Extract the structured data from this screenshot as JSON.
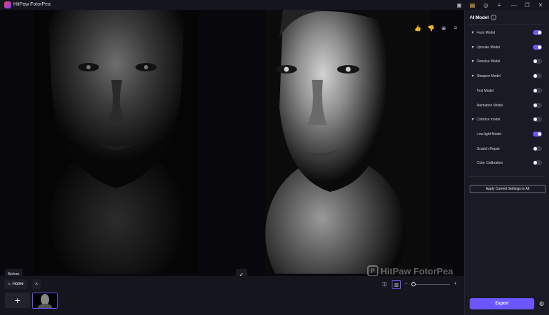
{
  "app": {
    "title": "HitPaw FotorPea"
  },
  "titlebar_icons": [
    {
      "name": "gamepad-icon",
      "glyph": "▣"
    },
    {
      "name": "gift-icon",
      "glyph": "▤"
    },
    {
      "name": "user-icon",
      "glyph": "◎"
    },
    {
      "name": "menu-icon",
      "glyph": "≡"
    },
    {
      "name": "minimize-icon",
      "glyph": "—"
    },
    {
      "name": "maximize-icon",
      "glyph": "❐"
    },
    {
      "name": "close-icon",
      "glyph": "✕"
    }
  ],
  "preview": {
    "before_label": "Before",
    "watermark": "HitPaw FotorPea",
    "tools": [
      {
        "name": "thumbs-up-icon",
        "glyph": "👍"
      },
      {
        "name": "thumbs-down-icon",
        "glyph": "👎"
      },
      {
        "name": "zoom-in-icon",
        "glyph": "⊕"
      },
      {
        "name": "crop-icon",
        "glyph": "⌗"
      }
    ]
  },
  "bottom": {
    "home_label": "Home"
  },
  "panel": {
    "title": "AI Model",
    "models": [
      {
        "label": "Face Model",
        "arrow": true,
        "on": true
      },
      {
        "label": "Upscale Model",
        "arrow": true,
        "on": true
      },
      {
        "label": "Denoise Model",
        "arrow": true,
        "on": false
      },
      {
        "label": "Sharpen Model",
        "arrow": true,
        "on": false
      },
      {
        "label": "Text Model",
        "arrow": false,
        "on": false
      },
      {
        "label": "Animation Model",
        "arrow": false,
        "on": false
      },
      {
        "label": "Colorize model",
        "arrow": true,
        "on": false
      },
      {
        "label": "Low-light Model",
        "arrow": false,
        "on": true
      },
      {
        "label": "Scratch Repair",
        "arrow": false,
        "on": false
      },
      {
        "label": "Color Calibration",
        "arrow": false,
        "on": false
      }
    ],
    "apply_label": "Apply Current Settings to All",
    "export_label": "Export"
  },
  "colors": {
    "accent": "#6b56ff",
    "panel_bg": "#1a1a24",
    "window_bg": "#0f0f16"
  }
}
